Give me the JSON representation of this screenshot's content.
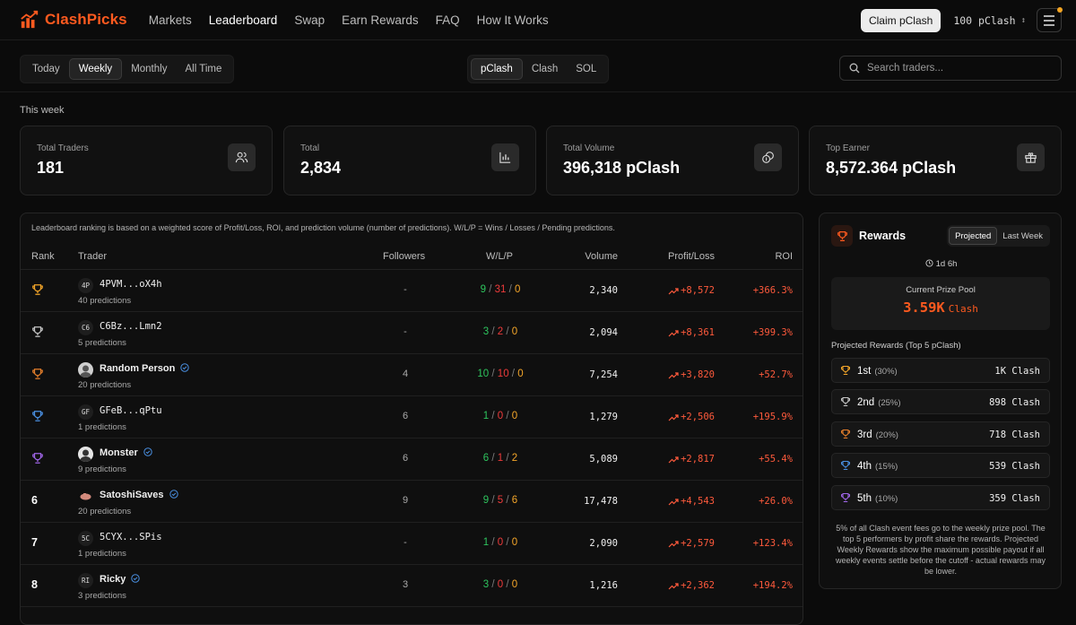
{
  "app": {
    "name": "ClashPicks",
    "brand_color": "#ff5a1f"
  },
  "nav": {
    "links": [
      {
        "label": "Markets"
      },
      {
        "label": "Leaderboard"
      },
      {
        "label": "Swap"
      },
      {
        "label": "Earn Rewards"
      },
      {
        "label": "FAQ"
      },
      {
        "label": "How It Works"
      }
    ],
    "active": "Leaderboard",
    "claim_label": "Claim pClash",
    "balance": "100 pClash",
    "menu_icon": "menu-icon",
    "notification_dot_color": "#f5a623"
  },
  "filters": {
    "periods": [
      "Today",
      "Weekly",
      "Monthly",
      "All Time"
    ],
    "active_period": "Weekly",
    "tokens": [
      "pClash",
      "Clash",
      "SOL"
    ],
    "active_token": "pClash",
    "search_placeholder": "Search traders..."
  },
  "period_label": "This week",
  "stats": [
    {
      "label": "Total Traders",
      "value": "181",
      "icon": "users-icon"
    },
    {
      "label": "Total",
      "value": "2,834",
      "icon": "bar-chart-icon"
    },
    {
      "label": "Total Volume",
      "value": "396,318 pClash",
      "icon": "coins-icon"
    },
    {
      "label": "Top Earner",
      "value": "8,572.364 pClash",
      "icon": "gift-icon"
    }
  ],
  "leaderboard": {
    "note": "Leaderboard ranking is based on a weighted score of Profit/Loss, ROI, and prediction volume (number of predictions). W/L/P = Wins / Losses / Pending predictions.",
    "columns": [
      "Rank",
      "Trader",
      "Followers",
      "W/L/P",
      "Volume",
      "Profit/Loss",
      "ROI"
    ],
    "rows": [
      {
        "rank": "1",
        "rank_icon": "gold-trophy-icon",
        "avatar": "4P",
        "name": "4PVM...oX4h",
        "predictions": "40 predictions",
        "followers": "-",
        "w": "9",
        "l": "31",
        "p": "0",
        "volume": "2,340",
        "pnl": "+8,572",
        "roi": "+366.3%"
      },
      {
        "rank": "2",
        "rank_icon": "silver-trophy-icon",
        "avatar": "C6",
        "name": "C6Bz...Lmn2",
        "predictions": "5 predictions",
        "followers": "-",
        "w": "3",
        "l": "2",
        "p": "0",
        "volume": "2,094",
        "pnl": "+8,361",
        "roi": "+399.3%"
      },
      {
        "rank": "3",
        "rank_icon": "bronze-trophy-icon",
        "avatar": "",
        "name": "Random Person",
        "predictions": "20 predictions",
        "followers": "4",
        "w": "10",
        "l": "10",
        "p": "0",
        "volume": "7,254",
        "pnl": "+3,820",
        "roi": "+52.7%",
        "verified": true
      },
      {
        "rank": "4",
        "rank_icon": "blue-trophy-icon",
        "avatar": "GF",
        "name": "GFeB...qPtu",
        "predictions": "1 predictions",
        "followers": "6",
        "w": "1",
        "l": "0",
        "p": "0",
        "volume": "1,279",
        "pnl": "+2,506",
        "roi": "+195.9%"
      },
      {
        "rank": "5",
        "rank_icon": "purple-trophy-icon",
        "avatar": "",
        "name": "Monster",
        "predictions": "9 predictions",
        "followers": "6",
        "w": "6",
        "l": "1",
        "p": "2",
        "volume": "5,089",
        "pnl": "+2,817",
        "roi": "+55.4%",
        "verified": true
      },
      {
        "rank": "6",
        "rank_icon": "",
        "avatar": "",
        "name": "SatoshiSaves",
        "predictions": "20 predictions",
        "followers": "9",
        "w": "9",
        "l": "5",
        "p": "6",
        "volume": "17,478",
        "pnl": "+4,543",
        "roi": "+26.0%",
        "verified": true
      },
      {
        "rank": "7",
        "rank_icon": "",
        "avatar": "5C",
        "name": "5CYX...SPis",
        "predictions": "1 predictions",
        "followers": "-",
        "w": "1",
        "l": "0",
        "p": "0",
        "volume": "2,090",
        "pnl": "+2,579",
        "roi": "+123.4%"
      },
      {
        "rank": "8",
        "rank_icon": "",
        "avatar": "RI",
        "name": "Ricky",
        "predictions": "3 predictions",
        "followers": "3",
        "w": "3",
        "l": "0",
        "p": "0",
        "volume": "1,216",
        "pnl": "+2,362",
        "roi": "+194.2%",
        "verified": true
      }
    ]
  },
  "rewards": {
    "title": "Rewards",
    "tabs": [
      "Projected",
      "Last Week"
    ],
    "active_tab": "Projected",
    "countdown": "1d 6h",
    "pool_label": "Current Prize Pool",
    "pool_amount": "3.59K",
    "pool_unit": "Clash",
    "projected_label": "Projected Rewards (Top 5 pClash)",
    "prizes": [
      {
        "place": "1st",
        "pct": "(30%)",
        "amount": "1K Clash",
        "color": "#f4a629"
      },
      {
        "place": "2nd",
        "pct": "(25%)",
        "amount": "898 Clash",
        "color": "#c7c7c7"
      },
      {
        "place": "3rd",
        "pct": "(20%)",
        "amount": "718 Clash",
        "color": "#e57f2b"
      },
      {
        "place": "4th",
        "pct": "(15%)",
        "amount": "539 Clash",
        "color": "#4a90e2"
      },
      {
        "place": "5th",
        "pct": "(10%)",
        "amount": "359 Clash",
        "color": "#a066e8"
      }
    ],
    "note": "5% of all Clash event fees go to the weekly prize pool. The top 5 performers by profit share the rewards. Projected Weekly Rewards show the maximum possible payout if all weekly events settle before the cutoff - actual rewards may be lower."
  },
  "colors": {
    "win": "#2ec45e",
    "loss": "#ef3b3b",
    "pending": "#f4a629",
    "profit": "#ff5a3c"
  }
}
